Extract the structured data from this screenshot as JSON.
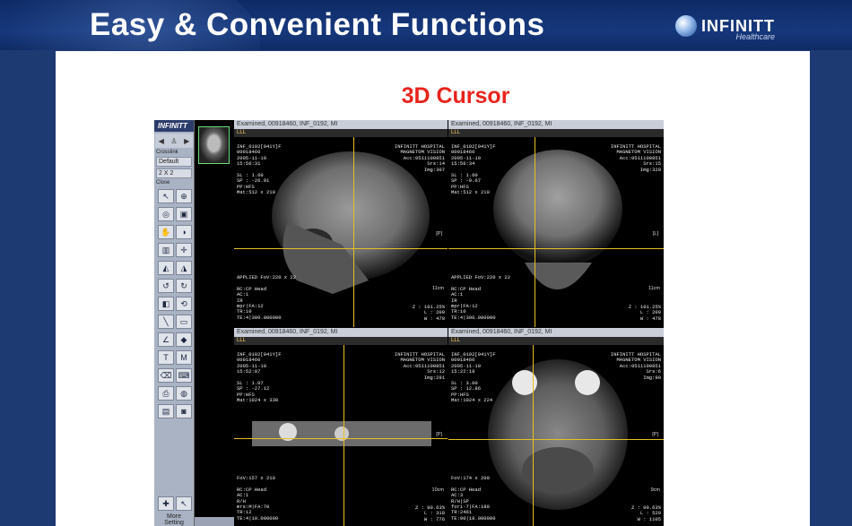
{
  "header": {
    "title": "Easy & Convenient Functions",
    "logo": {
      "name": "INFINITT",
      "sub": "Healthcare"
    }
  },
  "subtitle": "3D Cursor",
  "toolbar": {
    "brand": "INFINITT",
    "tool_select": "Crosslink",
    "layout_value": "Default",
    "grid_value": "2 X 2",
    "close_label": "Close",
    "more_label": "More",
    "setting_label": "Setting"
  },
  "thumbnail": {
    "label": "SLN"
  },
  "viewports": [
    {
      "title": "Examined, 00918460, INF_0192, MI",
      "ll": "LLL",
      "tl": "INF_0192[041Y]F\n00918460\n2005-11-10\n15:56:31\n\nSL : 1.60\nSP : -26.91\nPP:HFS\nMat:512 x 210",
      "tr": "INFINITT HOSPITAL\nMAGNETOM VISION\nAcc:0511100851\nSrs:14\nImg:307",
      "bl": "APPLIED FoV:220 x 22\n\nRC:CP Head\nAC:1\nIR\nmpr|FA:12\nTR:10\nTE:4|300.000000",
      "br": "Z : 101.25%\nL : 209\nW : 478",
      "orient": "[P]",
      "scale": "11cm"
    },
    {
      "title": "Examined, 00918460, INF_0192, MI",
      "ll": "LLL",
      "tl": "INF_0192[041Y]F\n00918460\n2005-11-10\n15:56:34\n\nSL : 1.60\nSP : -9.67\nPP:HFS\nMat:512 x 210",
      "tr": "INFINITT HOSPITAL\nMAGNETOM VISION\nAcc:0511100851\nSrs:15\nImg:329",
      "bl": "APPLIED FoV:220 x 22\n\nRC:CP Head\nAC:1\nIR\nmpr|FA:12\nTR:10\nTE:4|300.000000",
      "br": "Z : 101.25%\nL : 209\nW : 478",
      "orient": "[L]",
      "scale": "11cm"
    },
    {
      "title": "Examined, 00918460, INF_0192, MI",
      "ll": "LLL",
      "tl": "INF_0192[041Y]F\n00918460\n2005-11-10\n15:52:07\n\nSL : 1.07\nSP : -27.12\nPP:HFS\nMat:1024 x 330",
      "tr": "INFINITT HOSPITAL\nMAGNETOM VISION\nAcc:0511100851\nSrs:12\nImg:291",
      "bl": "FoV:157 x 210\n\nRC:CP Head\nAC:1\nR/H\nmrs:M|FA:70\nTR:12\nTE:4|10.000000",
      "br": "Z : 90.63%\nL : 318\nW : 776",
      "orient": "[P]",
      "scale": "10cm"
    },
    {
      "title": "Examined, 00918460, INF_0192, MI",
      "ll": "LLL",
      "tl": "INF_0192[041Y]F\n00918460\n2005-11-10\n15:22:19\n\nSL : 3.00\nSP : 12.86\nPP:HFS\nMat:1024 x 224",
      "tr": "INFINITT HOSPITAL\nMAGNETOM VISION\nAcc:0511100851\nSrs:6\nImg:99",
      "bl": "FoV:174 x 200\n\nRC:CP Head\nAC:3\nR/H|SP\nfor1-7|FA:180\nTR:2461\nTE:90|18.000000",
      "br": "Z : 90.63%\nL : 529\nW : 1105",
      "orient": "[P]",
      "scale": "9cm"
    }
  ]
}
